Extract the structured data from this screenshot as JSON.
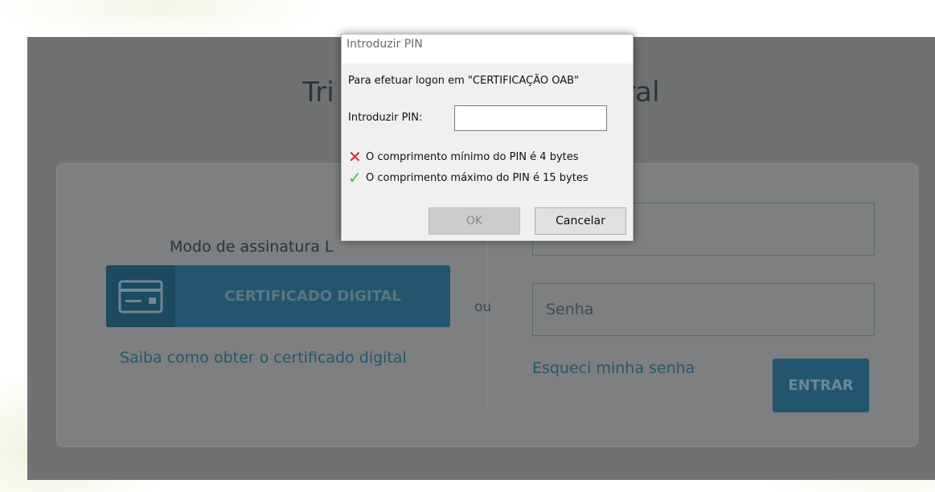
{
  "page": {
    "title_left": "Tri",
    "title_right": "ral"
  },
  "login": {
    "mode_label": "Modo de assinatura L",
    "cert_button_label": "CERTIFICADO DIGITAL",
    "cert_help_link": "Saiba como obter o certificado digital",
    "separator": "ou",
    "username_value": "",
    "password_placeholder": "Senha",
    "forgot_link": "Esqueci minha senha",
    "enter_button": "ENTRAR"
  },
  "dialog": {
    "title": "Introduzir PIN",
    "logon_text": "Para efetuar logon em \"CERTIFICAÇÃO OAB\"",
    "pin_label": "Introduzir PIN:",
    "pin_value": "",
    "requirements": [
      {
        "icon": "x-icon",
        "status": "fail",
        "text": "O comprimento mínimo do PIN é 4 bytes"
      },
      {
        "icon": "checkmark-icon",
        "status": "ok",
        "text": "O comprimento máximo do PIN é 15 bytes"
      }
    ],
    "ok_button": "OK",
    "cancel_button": "Cancelar"
  },
  "colors": {
    "overlay": "#6f7172",
    "brand_button": "#23566e",
    "dialog_bg": "#f0f0f0",
    "fail": "#e02020",
    "ok": "#3cc43c"
  }
}
